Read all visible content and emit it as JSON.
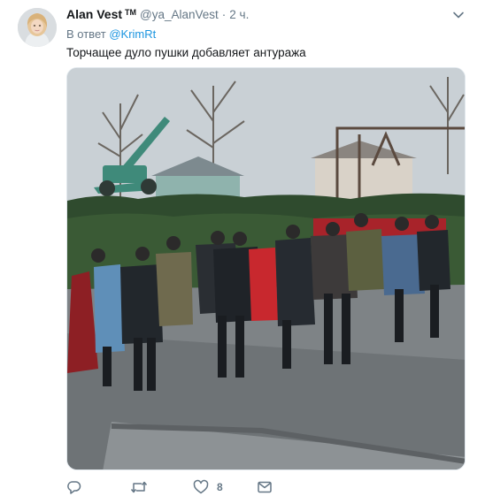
{
  "tweet": {
    "author": {
      "display_name": "Alan Vest",
      "badge": "TM",
      "handle": "@ya_AlanVest",
      "avatar_icon": "avatar-photo"
    },
    "separator": "·",
    "time": "2 ч.",
    "reply_to": {
      "prefix": "В ответ",
      "mention": "@KrimRt"
    },
    "text": "Торчащее дуло пушки добавляет антуража",
    "media": {
      "kind": "photo",
      "subject": "funeral-procession-with-artillery-gun"
    },
    "actions": {
      "reply": {
        "icon": "reply-icon",
        "count": ""
      },
      "retweet": {
        "icon": "retweet-icon",
        "count": ""
      },
      "like": {
        "icon": "heart-icon",
        "count": "8"
      },
      "direct_message": {
        "icon": "envelope-icon",
        "count": ""
      }
    }
  },
  "colors": {
    "text_primary": "#14171a",
    "text_secondary": "#657786",
    "link": "#1b95e0",
    "border": "#e1e8ed"
  }
}
